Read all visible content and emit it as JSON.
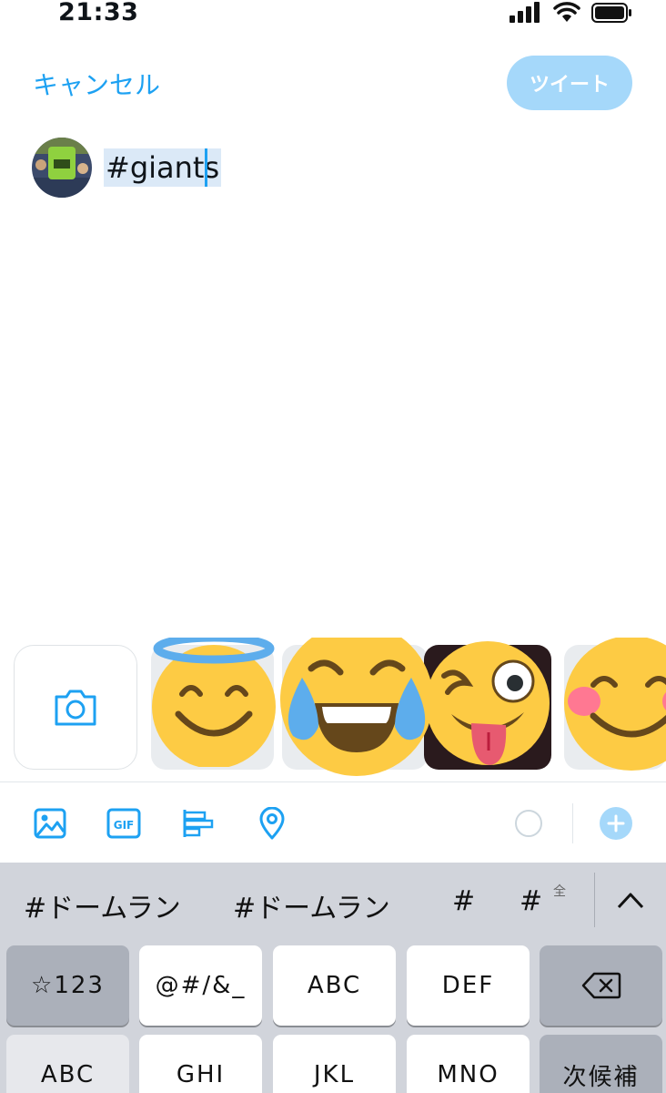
{
  "status_bar": {
    "time": "21:33"
  },
  "header": {
    "cancel_label": "キャンセル",
    "tweet_label": "ツイート"
  },
  "composer": {
    "text": "#giants"
  },
  "colors": {
    "accent": "#1da1f2",
    "tweet_disabled": "#a5d8fa",
    "keyboard_bg": "#d1d4db"
  },
  "toolbar": {
    "icons": [
      "image-icon",
      "gif-icon",
      "poll-icon",
      "location-icon",
      "char-counter",
      "add-icon"
    ],
    "gif_label": "GIF"
  },
  "keyboard": {
    "candidates": [
      "#ドームラン",
      "#ドームラン",
      "#",
      "#"
    ],
    "zen_label": "全",
    "row1": [
      "☆123",
      "@#/&_",
      "ABC",
      "DEF"
    ],
    "row2": [
      "ABC",
      "GHI",
      "JKL",
      "MNO",
      "次候補"
    ]
  }
}
